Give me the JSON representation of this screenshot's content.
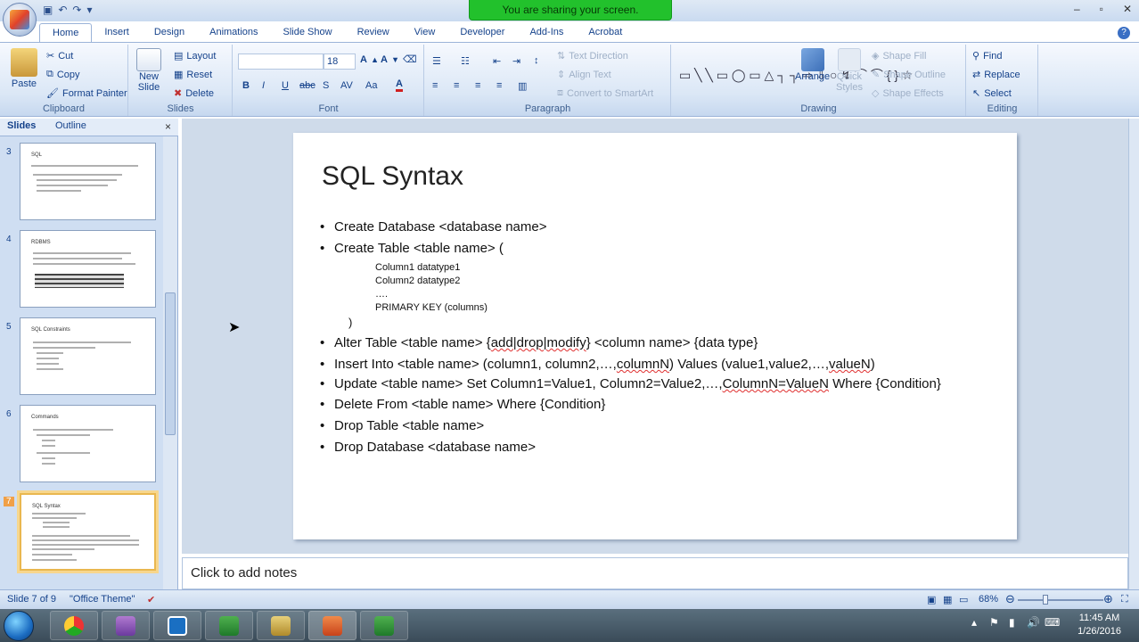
{
  "titlebar": {
    "share_banner": "You are sharing your screen."
  },
  "ribbon_tabs": [
    "Home",
    "Insert",
    "Design",
    "Animations",
    "Slide Show",
    "Review",
    "View",
    "Developer",
    "Add-Ins",
    "Acrobat"
  ],
  "clipboard": {
    "paste": "Paste",
    "cut": "Cut",
    "copy": "Copy",
    "format_painter": "Format Painter",
    "label": "Clipboard"
  },
  "slides_group": {
    "new_slide_line1": "New",
    "new_slide_line2": "Slide",
    "layout": "Layout",
    "reset": "Reset",
    "delete": "Delete",
    "label": "Slides"
  },
  "font": {
    "font_size": "18",
    "bold": "B",
    "italic": "I",
    "underline": "U",
    "strike": "abc",
    "shadow": "S",
    "spacing": "AV",
    "case": "Aa",
    "color": "A",
    "label": "Font"
  },
  "paragraph": {
    "text_direction": "Text Direction",
    "align_text": "Align Text",
    "convert_smartart": "Convert to SmartArt",
    "label": "Paragraph"
  },
  "drawing": {
    "arrange": "Arrange",
    "quick_styles_line1": "Quick",
    "quick_styles_line2": "Styles",
    "shape_fill": "Shape Fill",
    "shape_outline": "Shape Outline",
    "shape_effects": "Shape Effects",
    "label": "Drawing"
  },
  "editing": {
    "find": "Find",
    "replace": "Replace",
    "select": "Select",
    "label": "Editing"
  },
  "panel": {
    "tab_slides": "Slides",
    "tab_outline": "Outline",
    "thumbs": [
      {
        "num": "3",
        "title": "SQL"
      },
      {
        "num": "4",
        "title": "RDBMS"
      },
      {
        "num": "5",
        "title": "SQL Constraints"
      },
      {
        "num": "6",
        "title": "Commands"
      },
      {
        "num": "7",
        "title": "SQL Syntax"
      }
    ]
  },
  "slide": {
    "title": "SQL Syntax",
    "b1": "Create Database <database name>",
    "b2": "Create Table <table name> (",
    "sub1": "Column1  datatype1",
    "sub2": "Column2  datatype2",
    "sub3": "….",
    "sub4": "PRIMARY KEY (columns)",
    "paren": ")",
    "b3_pre": "Alter Table <table name> {",
    "b3_mid": "add|drop|modify",
    "b3_post": "} <column name> {data type}",
    "b4_pre": "Insert Into <table name> (column1, column2,…,",
    "b4_mid": "columnN",
    "b4_post": ") Values (value1,value2,…,",
    "b4_mid2": "valueN",
    "b4_end": ")",
    "b5_pre": "Update <table name>  Set Column1=Value1, Column2=Value2,…,",
    "b5_mid": "ColumnN=ValueN",
    "b5_post": " Where {Condition}",
    "b6": "Delete From <table name> Where {Condition}",
    "b7": "Drop Table <table name>",
    "b8": "Drop Database <database name>"
  },
  "notes": "Click to add notes",
  "status": {
    "slide_of": "Slide 7 of 9",
    "theme": "\"Office Theme\"",
    "zoom": "68%"
  },
  "clock": {
    "time": "11:45 AM",
    "date": "1/26/2016"
  }
}
